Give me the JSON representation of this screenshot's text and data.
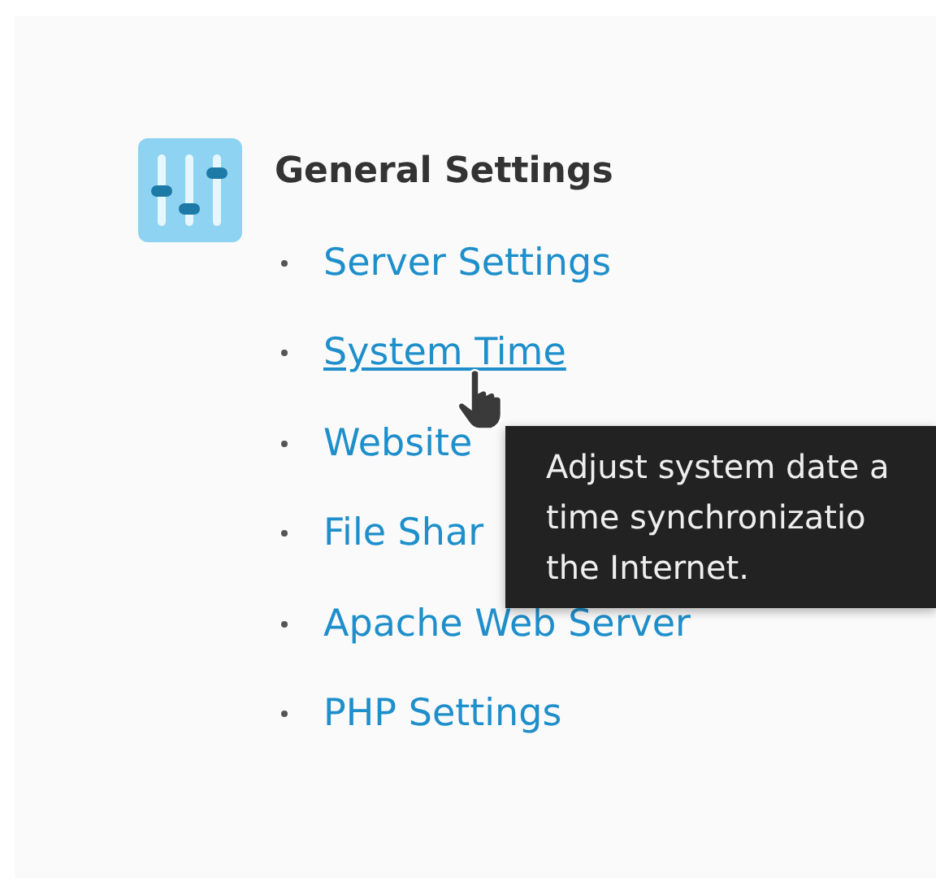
{
  "section": {
    "title": "General Settings",
    "links": [
      {
        "label": "Server Settings",
        "hovered": false
      },
      {
        "label": "System Time",
        "hovered": true
      },
      {
        "label": "Website",
        "hovered": false
      },
      {
        "label": "File Shar",
        "hovered": false
      },
      {
        "label": "Apache Web Server",
        "hovered": false
      },
      {
        "label": "PHP Settings",
        "hovered": false
      }
    ]
  },
  "tooltip": {
    "lines": [
      "Adjust system date a",
      "time synchronizatio",
      "the Internet."
    ]
  }
}
